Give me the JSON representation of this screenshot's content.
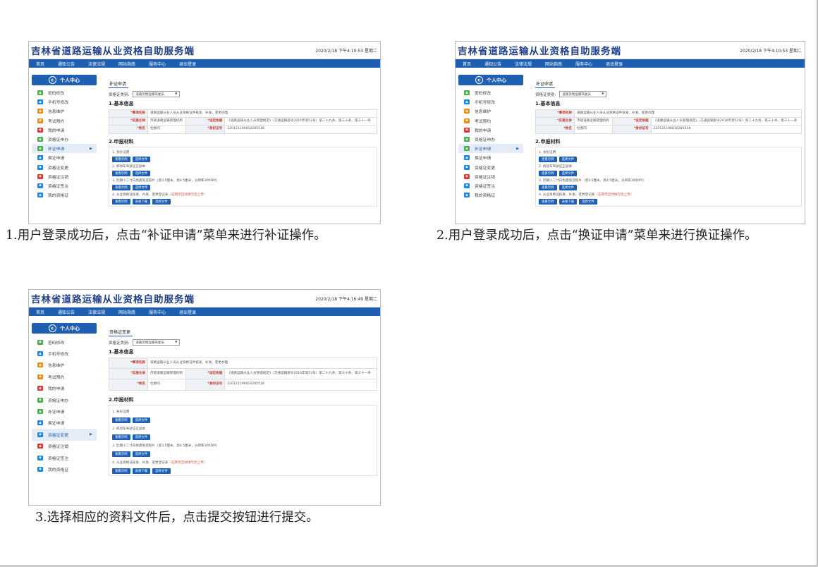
{
  "header": {
    "title": "吉林省道路运输从业资格自助服务端"
  },
  "nav": [
    "首页",
    "通知公告",
    "法律法规",
    "网站指南",
    "服务中心",
    "退出登录"
  ],
  "sidebar": {
    "title": "个人中心",
    "items": [
      "密码修改",
      "手机号修改",
      "信息维护",
      "考试预约",
      "我的申请",
      "资格证申办",
      "补证申请",
      "换证申请",
      "资格证变更",
      "资格证注销",
      "资格证签注",
      "我的资格证"
    ]
  },
  "icon_colors": [
    "#4caf50",
    "#1e88e5",
    "#ef8c1c",
    "#ef8c1c",
    "#e53935",
    "#4caf50",
    "#4caf50",
    "#1e88e5",
    "#1e88e5",
    "#e53935",
    "#1e88e5",
    "#1e88e5"
  ],
  "form": {
    "cert_label": "资格证类别:",
    "cert_value": "道路货物运输驾驶员",
    "sec1": "1.基本信息",
    "labels": {
      "item_name": "*事项名称",
      "subject": "*实施主体",
      "basis": "*设定依据",
      "name": "*姓名",
      "id": "*身份证号"
    },
    "values": {
      "item_name": "道路运输从业人员从业资格证件核发、补发、变更办理",
      "subject": "市级道路运输管理机构",
      "basis": "《道路运输从业人员管理规定》（交通运输部令2016年第52号）第二十九条、第三十条、第三十一条",
      "name": "杜春同",
      "id": "220121196810285518"
    },
    "sec2": "2.申报材料",
    "materials": [
      {
        "text": "1. 身份证明",
        "note": ""
      },
      {
        "text": "2. 机动车驾驶证正副本",
        "note": ""
      },
      {
        "text": "3. 近期小二寸白色底免冠照片（宽3.5厘米，高4.5厘米，分辨率300DPI）",
        "note": ""
      },
      {
        "text": "4. 从业资格证核发、补发、变更登记表",
        "note": "（在网页自动填写后上传）"
      }
    ],
    "buttons": {
      "view": "查看示例",
      "choose": "选择文件",
      "download": "表格下载"
    }
  },
  "panels": [
    {
      "date": "2020/2/18 下午4:10:53 星期二",
      "tab": "补证申请",
      "active": 6,
      "caption": "1.用户登录成功后，点击“补证申请”菜单来进行补证操作。"
    },
    {
      "date": "2020/2/18 下午4:10:53 星期二",
      "tab": "补证申请",
      "active": 6,
      "caption": "2.用户登录成功后，点击“换证申请”菜单来进行换证操作。"
    },
    {
      "date": "2020/2/18 下午4:16:49 星期二",
      "tab": "资格证变更",
      "active": 8,
      "caption": "3.选择相应的资料文件后，点击提交按钮进行提交。"
    }
  ]
}
